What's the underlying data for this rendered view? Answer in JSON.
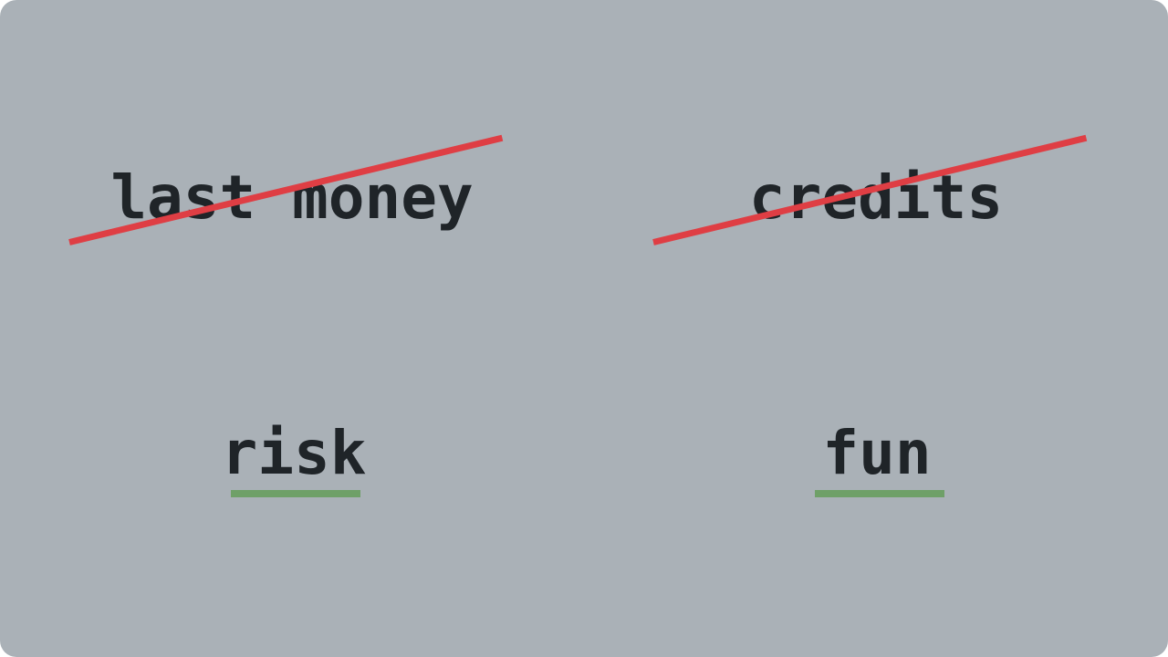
{
  "colors": {
    "background": "#aab1b7",
    "text": "#1f2428",
    "strike": "#df3e44",
    "underline": "#6fa068"
  },
  "words": {
    "crossed": [
      "last money",
      "credits"
    ],
    "underlined": [
      "risk",
      "fun"
    ]
  }
}
